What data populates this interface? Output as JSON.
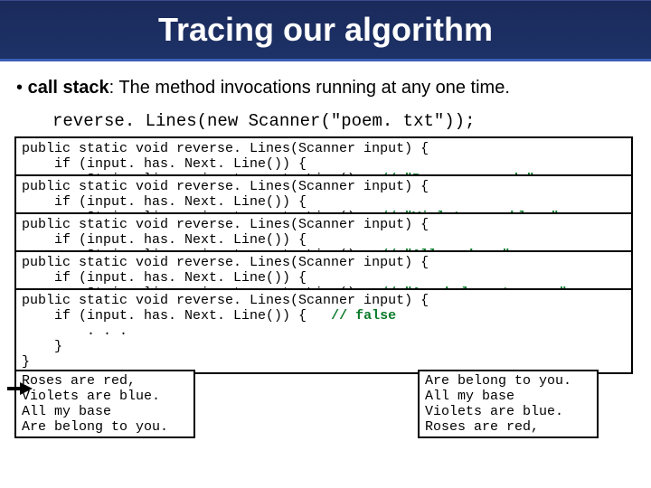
{
  "title": "Tracing our algorithm",
  "bullet": {
    "marker": "•",
    "term": "call stack",
    "def": ": The method invocations running at any one time."
  },
  "invoke": "reverse. Lines(new Scanner(\"poem. txt\"));",
  "frames": [
    {
      "l1": "public static void reverse. Lines(Scanner input) {",
      "l2": "    if (input. has. Next. Line()) {",
      "l3a": "        String line = input. next. Line();  ",
      "l3b": "// \"Roses are red,\""
    },
    {
      "l1": "public static void reverse. Lines(Scanner input) {",
      "l2": "    if (input. has. Next. Line()) {",
      "l3a": "        String line = input. next. Line();  ",
      "l3b": "// \"Violets are blue.\""
    },
    {
      "l1": "public static void reverse. Lines(Scanner input) {",
      "l2": "    if (input. has. Next. Line()) {",
      "l3a": "        String line = input. next. Line();  ",
      "l3b": "// \"All my base\""
    },
    {
      "l1": "public static void reverse. Lines(Scanner input) {",
      "l2": "    if (input. has. Next. Line()) {",
      "l3a": "        String line = input. next. Line();  ",
      "l3b": "// \"Are belong to you.\""
    }
  ],
  "frame5": {
    "l1": "public static void reverse. Lines(Scanner input) {",
    "l2a": "    if (input. has. Next. Line()) {   ",
    "l2b": "// false",
    "l3": "        . . .",
    "l4": "    }",
    "l5": "}"
  },
  "left_out": "Roses are red,\nViolets are blue.\nAll my base\nAre belong to you.",
  "right_out": "Are belong to you.\nAll my base\nViolets are blue.\nRoses are red,"
}
